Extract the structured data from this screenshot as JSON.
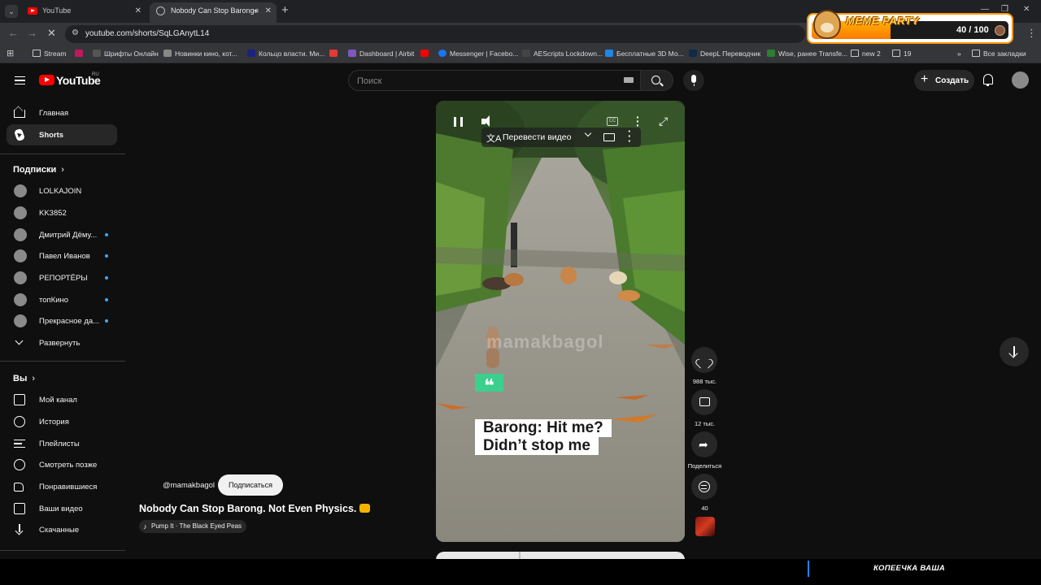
{
  "browser": {
    "tabs": [
      {
        "title": "YouTube",
        "active": false
      },
      {
        "title": "Nobody Can Stop Barong.",
        "active": true
      }
    ],
    "url": "youtube.com/shorts/SqLGAnytL14",
    "bookmarks": [
      {
        "label": "Stream",
        "icon": "folder-icon"
      },
      {
        "label": "Шрифты Онлайн",
        "icon": "site-icon"
      },
      {
        "label": "Новинки кино, кот...",
        "icon": "site-icon"
      },
      {
        "label": "Кольцо власти. Ми...",
        "icon": "site-icon"
      },
      {
        "label": "Dashboard | Airbit",
        "icon": "site-icon"
      },
      {
        "label": "Messenger | Facebo...",
        "icon": "messenger-icon"
      },
      {
        "label": "AEScripts Lockdown...",
        "icon": "site-icon"
      },
      {
        "label": "Бесплатные 3D Мо...",
        "icon": "site-icon"
      },
      {
        "label": "DeepL Переводчик",
        "icon": "site-icon"
      },
      {
        "label": "Wise, ранее Transfe...",
        "icon": "site-icon"
      },
      {
        "label": "new 2",
        "icon": "folder-icon"
      },
      {
        "label": "19",
        "icon": "folder-icon"
      }
    ],
    "all_bookmarks": "Все закладки"
  },
  "meme_party": {
    "title": "MEME PARTY",
    "count": "40 / 100",
    "progress": 0.4,
    "accent": "#ff9800"
  },
  "header": {
    "logo": "YouTube",
    "region": "RU",
    "search_placeholder": "Поиск",
    "create_label": "Создать"
  },
  "sidebar": {
    "main": [
      {
        "label": "Главная",
        "icon": "home-icon"
      },
      {
        "label": "Shorts",
        "icon": "shorts-icon",
        "active": true
      }
    ],
    "subs_heading": "Подписки",
    "subscriptions": [
      {
        "label": "LOLKAJOIN",
        "new": false
      },
      {
        "label": "KK3852",
        "new": false
      },
      {
        "label": "Дмитрий Дёму...",
        "new": true
      },
      {
        "label": "Павел Иванов",
        "new": true
      },
      {
        "label": "РЕПОРТЁРЫ",
        "new": true
      },
      {
        "label": "топКино",
        "new": true
      },
      {
        "label": "Прекрасное да...",
        "new": true
      }
    ],
    "expand_label": "Развернуть",
    "you_heading": "Вы",
    "you_items": [
      {
        "label": "Мой канал",
        "icon": "channel-icon"
      },
      {
        "label": "История",
        "icon": "history-icon"
      },
      {
        "label": "Плейлисты",
        "icon": "playlists-icon"
      },
      {
        "label": "Смотреть позже",
        "icon": "watch-later-icon"
      },
      {
        "label": "Понравившиеся",
        "icon": "like-icon"
      },
      {
        "label": "Ваши видео",
        "icon": "your-videos-icon"
      },
      {
        "label": "Скачанные",
        "icon": "download-icon"
      }
    ]
  },
  "player": {
    "translate_label": "Перевести видео",
    "watermark": "mamakbagol",
    "quote_mark": "❝",
    "caption_lines": [
      "Barong: Hit me?",
      "Didn’t stop me"
    ]
  },
  "actions": {
    "likes": "988 тыс.",
    "comments": "12 тыс.",
    "share": "Поделиться",
    "remix": "40"
  },
  "video": {
    "handle": "@mamakbagol",
    "subscribe_label": "Подписаться",
    "title": "Nobody Can Stop Barong. Not Even Physics.",
    "music": "Pump It · The Black Eyed Peas"
  },
  "overlay": {
    "brand": "КОПЕЕЧКА ВАША"
  }
}
